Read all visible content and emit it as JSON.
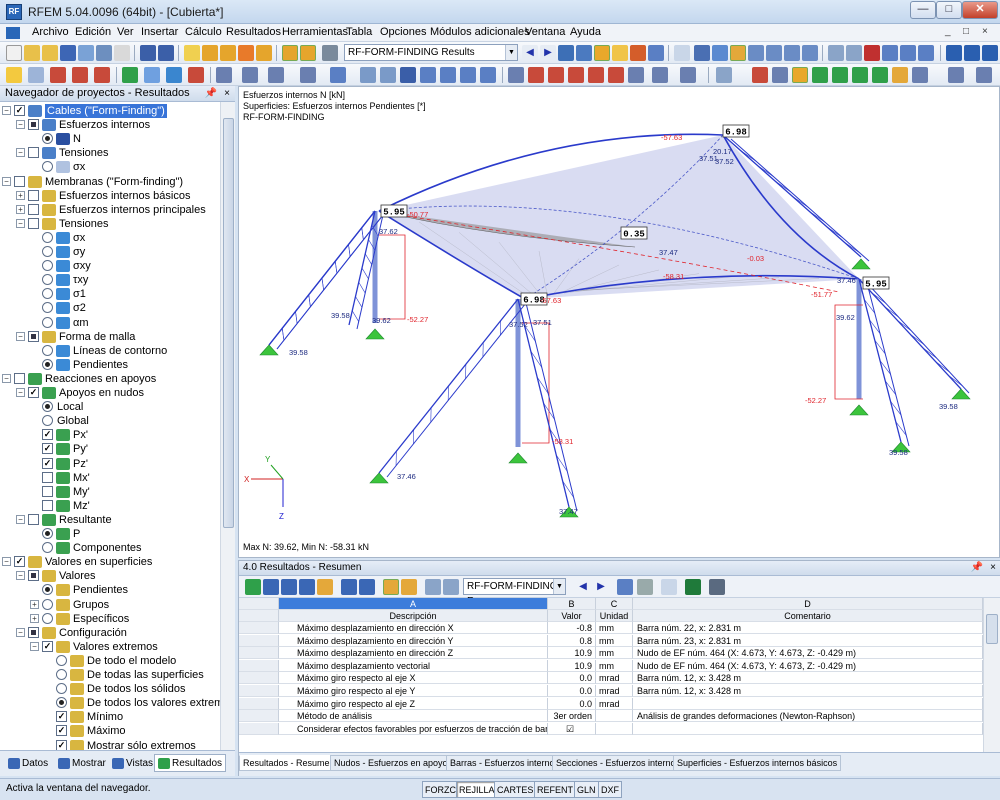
{
  "window": {
    "title": "RFEM 5.04.0096 (64bit) - [Cubierta*]",
    "app_icon_text": "RF",
    "min": "—",
    "max": "□",
    "close": "✕"
  },
  "menu": {
    "items": [
      "Archivo",
      "Edición",
      "Ver",
      "Insertar",
      "Cálculo",
      "Resultados",
      "Herramientas",
      "Tabla",
      "Opciones",
      "Módulos adicionales",
      "Ventana",
      "Ayuda"
    ],
    "mdi_controls": [
      "_",
      "□",
      "×"
    ]
  },
  "toolbar": {
    "case_combo": "RF-FORM-FINDING Results",
    "combo_arrow": "▼"
  },
  "navigator": {
    "title": "Navegador de proyectos - Resultados",
    "pin": "📌",
    "close": "×",
    "items": [
      {
        "label": "Cables (\"Form-Finding\")",
        "selected": true
      },
      {
        "label": "Esfuerzos internos"
      },
      {
        "label": "N"
      },
      {
        "label": "Tensiones"
      },
      {
        "label": "σx"
      },
      {
        "label": "Membranas (\"Form-finding\")"
      },
      {
        "label": "Esfuerzos internos básicos"
      },
      {
        "label": "Esfuerzos internos principales"
      },
      {
        "label": "Tensiones"
      },
      {
        "label": "σx"
      },
      {
        "label": "σy"
      },
      {
        "label": "σxy"
      },
      {
        "label": "τxy"
      },
      {
        "label": "σ1"
      },
      {
        "label": "σ2"
      },
      {
        "label": "αm"
      },
      {
        "label": "Forma de malla"
      },
      {
        "label": "Líneas de contorno"
      },
      {
        "label": "Pendientes"
      },
      {
        "label": "Reacciones en apoyos"
      },
      {
        "label": "Apoyos en nudos"
      },
      {
        "label": "Local"
      },
      {
        "label": "Global"
      },
      {
        "label": "Px'"
      },
      {
        "label": "Py'"
      },
      {
        "label": "Pz'"
      },
      {
        "label": "Mx'"
      },
      {
        "label": "My'"
      },
      {
        "label": "Mz'"
      },
      {
        "label": "Resultante"
      },
      {
        "label": "P"
      },
      {
        "label": "Componentes"
      },
      {
        "label": "Valores en superficies"
      },
      {
        "label": "Valores"
      },
      {
        "label": "Pendientes"
      },
      {
        "label": "Grupos"
      },
      {
        "label": "Específicos"
      },
      {
        "label": "Configuración"
      },
      {
        "label": "Valores extremos"
      },
      {
        "label": "De todo el modelo"
      },
      {
        "label": "De todas las superficies"
      },
      {
        "label": "De todos los sólidos"
      },
      {
        "label": "De todos los valores extremos"
      },
      {
        "label": "Mínimo"
      },
      {
        "label": "Máximo"
      },
      {
        "label": "Mostrar sólo extremos"
      }
    ],
    "tabs": [
      "Datos",
      "Mostrar",
      "Vistas",
      "Resultados"
    ]
  },
  "view": {
    "header_lines": [
      "Esfuerzos internos N [kN]",
      "Superficies: Esfuerzos internos Pendientes [*]",
      "RF-FORM-FINDING"
    ],
    "footer": "Max N: 39.62, Min N: -58.31 kN",
    "boxed_labels": [
      "6.98",
      "5.95",
      "0.35",
      "6.98",
      "5.95"
    ],
    "value_labels": [
      "-57.63",
      "37.51",
      "37.52",
      "20.17",
      "-50.77",
      "37.62",
      "37.47",
      "-0.03",
      "-58.31",
      "37.46",
      "-51.77",
      "39.62",
      "-57.63",
      "37.51",
      "37.52",
      "-52.27",
      "39.58",
      "39.58",
      "39.62",
      "-52.27",
      "39.58",
      "-58.31",
      "39.58",
      "37.46",
      "37.47"
    ],
    "axes": {
      "x": "X",
      "y": "Y",
      "z": "Z"
    },
    "colors": {
      "membrane": "#b9c0e8",
      "cable": "#2a3acb",
      "negative": "#e0242c",
      "support": "#3cc43c"
    }
  },
  "results": {
    "title": "4.0 Resultados - Resumen",
    "pin": "📌",
    "close": "×",
    "combo": "RF-FORM-FINDING Re",
    "combo_arrow": "▼",
    "columns": [
      {
        "letter": "A",
        "name": "Descripción"
      },
      {
        "letter": "B",
        "name": "Valor"
      },
      {
        "letter": "C",
        "name": "Unidad"
      },
      {
        "letter": "D",
        "name": "Comentario"
      }
    ],
    "rows": [
      {
        "desc": "Máximo desplazamiento en dirección X",
        "val": "-0.8",
        "unit": "mm",
        "comment": "Barra núm. 22,  x: 2.831 m"
      },
      {
        "desc": "Máximo desplazamiento en dirección Y",
        "val": "0.8",
        "unit": "mm",
        "comment": "Barra núm. 23,  x: 2.831 m"
      },
      {
        "desc": "Máximo desplazamiento en dirección Z",
        "val": "10.9",
        "unit": "mm",
        "comment": "Nudo de EF núm. 464  (X: 4.673,  Y: 4.673,  Z: -0.429 m)"
      },
      {
        "desc": "Máximo desplazamiento vectorial",
        "val": "10.9",
        "unit": "mm",
        "comment": "Nudo de EF núm. 464  (X: 4.673,  Y: 4.673,  Z: -0.429 m)"
      },
      {
        "desc": "Máximo giro respecto al eje X",
        "val": "0.0",
        "unit": "mrad",
        "comment": "Barra núm. 12,  x: 3.428 m"
      },
      {
        "desc": "Máximo giro respecto al eje Y",
        "val": "0.0",
        "unit": "mrad",
        "comment": "Barra núm. 12,  x: 3.428 m"
      },
      {
        "desc": "Máximo giro respecto al eje Z",
        "val": "0.0",
        "unit": "mrad",
        "comment": ""
      },
      {
        "desc": "Método de análisis",
        "val": "3er orden",
        "unit": "",
        "comment": "Análisis de grandes deformaciones (Newton-Raphson)"
      },
      {
        "desc": "Considerar efectos favorables por esfuerzos de tracción de barras",
        "val": "☑",
        "unit": "",
        "comment": ""
      }
    ],
    "tabs": [
      "Resultados - Resumen",
      "Nudos - Esfuerzos en apoyos",
      "Barras - Esfuerzos internos",
      "Secciones - Esfuerzos internos",
      "Superficies - Esfuerzos internos básicos"
    ]
  },
  "status": {
    "text": "Activa la ventana del navegador.",
    "buttons": [
      "FORZC",
      "REJILLA",
      "CARTES",
      "REFENT",
      "GLN",
      "DXF"
    ]
  }
}
